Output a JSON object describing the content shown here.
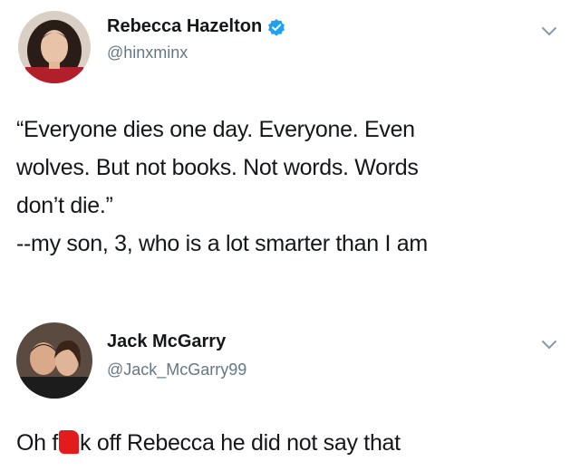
{
  "tweets": [
    {
      "author": "Rebecca Hazelton",
      "handle": "@hinxminx",
      "verified": true,
      "lines": [
        "“Everyone dies one day. Everyone. Even",
        "wolves. But not books. Not words. Words",
        "don’t die.”",
        "--my son, 3, who is a lot smarter than I am"
      ]
    },
    {
      "author": "Jack McGarry",
      "handle": "@Jack_McGarry99",
      "verified": false,
      "text_before": "Oh f",
      "text_after": "k off Rebecca he did not say that"
    }
  ],
  "colors": {
    "text": "#14171a",
    "secondary": "#657786",
    "verified_badge": "#1da1f2",
    "censor": "#e31b1b"
  },
  "icons": [
    "verified-badge-icon",
    "chevron-down-icon"
  ]
}
